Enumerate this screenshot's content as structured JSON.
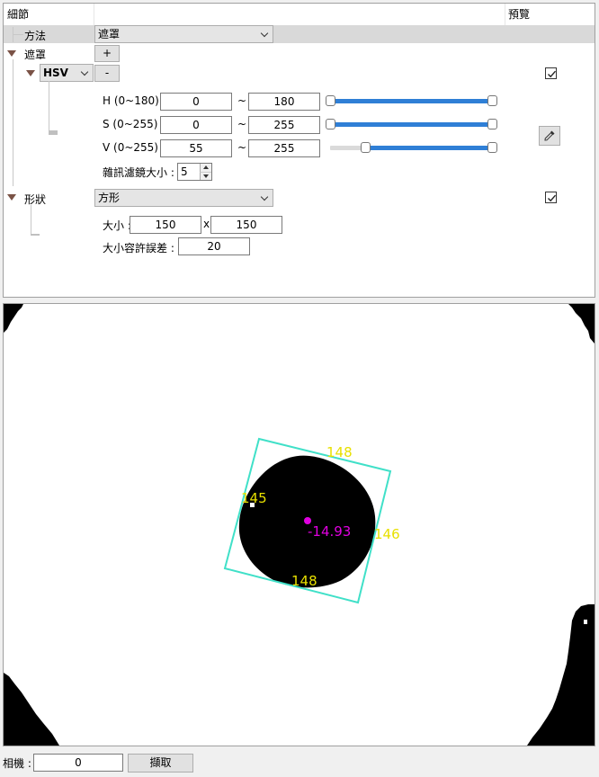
{
  "header": {
    "details": "細節",
    "preview": "預覽"
  },
  "method": {
    "label": "方法",
    "value": "遮罩"
  },
  "mask": {
    "label": "遮罩",
    "add_label": "+",
    "remove_label": "-",
    "colorspace": "HSV",
    "h": {
      "label": "H (0~180) :",
      "min": "0",
      "max": "180",
      "sep": "~",
      "low_pct": 0,
      "high_pct": 100
    },
    "s": {
      "label": "S (0~255) :",
      "min": "0",
      "max": "255",
      "sep": "~",
      "low_pct": 0,
      "high_pct": 100
    },
    "v": {
      "label": "V (0~255) :",
      "min": "55",
      "max": "255",
      "sep": "~",
      "low_pct": 21.6,
      "high_pct": 100
    },
    "noise_label": "雜訊濾鏡大小 :",
    "noise_value": "5",
    "preview_checked": true
  },
  "shape": {
    "label": "形狀",
    "value": "方形",
    "size_label": "大小 :",
    "width": "150",
    "x_sep": "x",
    "height": "150",
    "tolerance_label": "大小容許誤差 :",
    "tolerance": "20",
    "preview_checked": true
  },
  "overlay": {
    "top": "148",
    "left": "145",
    "right": "146",
    "bottom": "148",
    "angle": "-14.93",
    "box_color": "#40e0c8",
    "text_color": "#e8e000",
    "center_color": "#e000e0"
  },
  "footer": {
    "camera_label": "相機 :",
    "camera_value": "0",
    "capture_label": "擷取"
  }
}
